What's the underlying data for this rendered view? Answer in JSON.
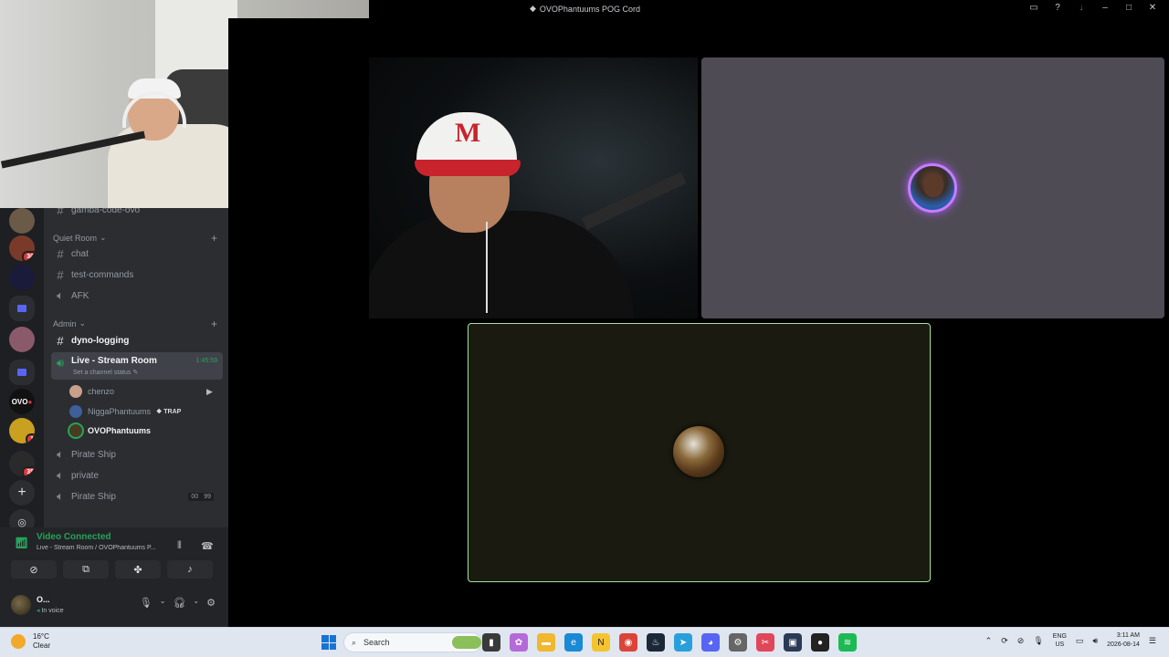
{
  "window": {
    "title": "OVOPhantuums POG Cord"
  },
  "channels": {
    "top_partial": "gamba-code-ovo",
    "categories": {
      "quiet_room": "Quiet Room",
      "admin": "Admin"
    },
    "quiet_room_items": [
      "chat",
      "test-commands",
      "AFK"
    ],
    "admin_items": {
      "dyno": "dyno-logging",
      "live": "Live - Stream Room",
      "live_timer": "1:45:59",
      "live_status": "Set a channel status",
      "pirate1": "Pirate Ship",
      "private": "private",
      "pirate2": "Pirate Ship",
      "pirate2_counts": [
        "00",
        "99"
      ]
    },
    "members": [
      {
        "name": "chenzo"
      },
      {
        "name": "NiggaPhantuums",
        "tag": "TRAP"
      },
      {
        "name": "OVOPhantuums"
      }
    ]
  },
  "rail": {
    "badges": [
      "30",
      "1",
      "35"
    ],
    "server_labels": [
      "OVO"
    ]
  },
  "voice": {
    "status": "Video Connected",
    "location": "Live - Stream Room / OVOPhantuums P..."
  },
  "user": {
    "name": "O...",
    "status": "In voice"
  },
  "taskbar": {
    "temp": "16°C",
    "condition": "Clear",
    "search_placeholder": "Search",
    "lang_top": "ENG",
    "lang_bottom": "US",
    "time": "3:11 AM",
    "date": "2026-08-14"
  },
  "colors": {
    "accent_green": "#23a559",
    "speaking_ring": "#c77dff",
    "active_border": "#a3e3a0"
  }
}
